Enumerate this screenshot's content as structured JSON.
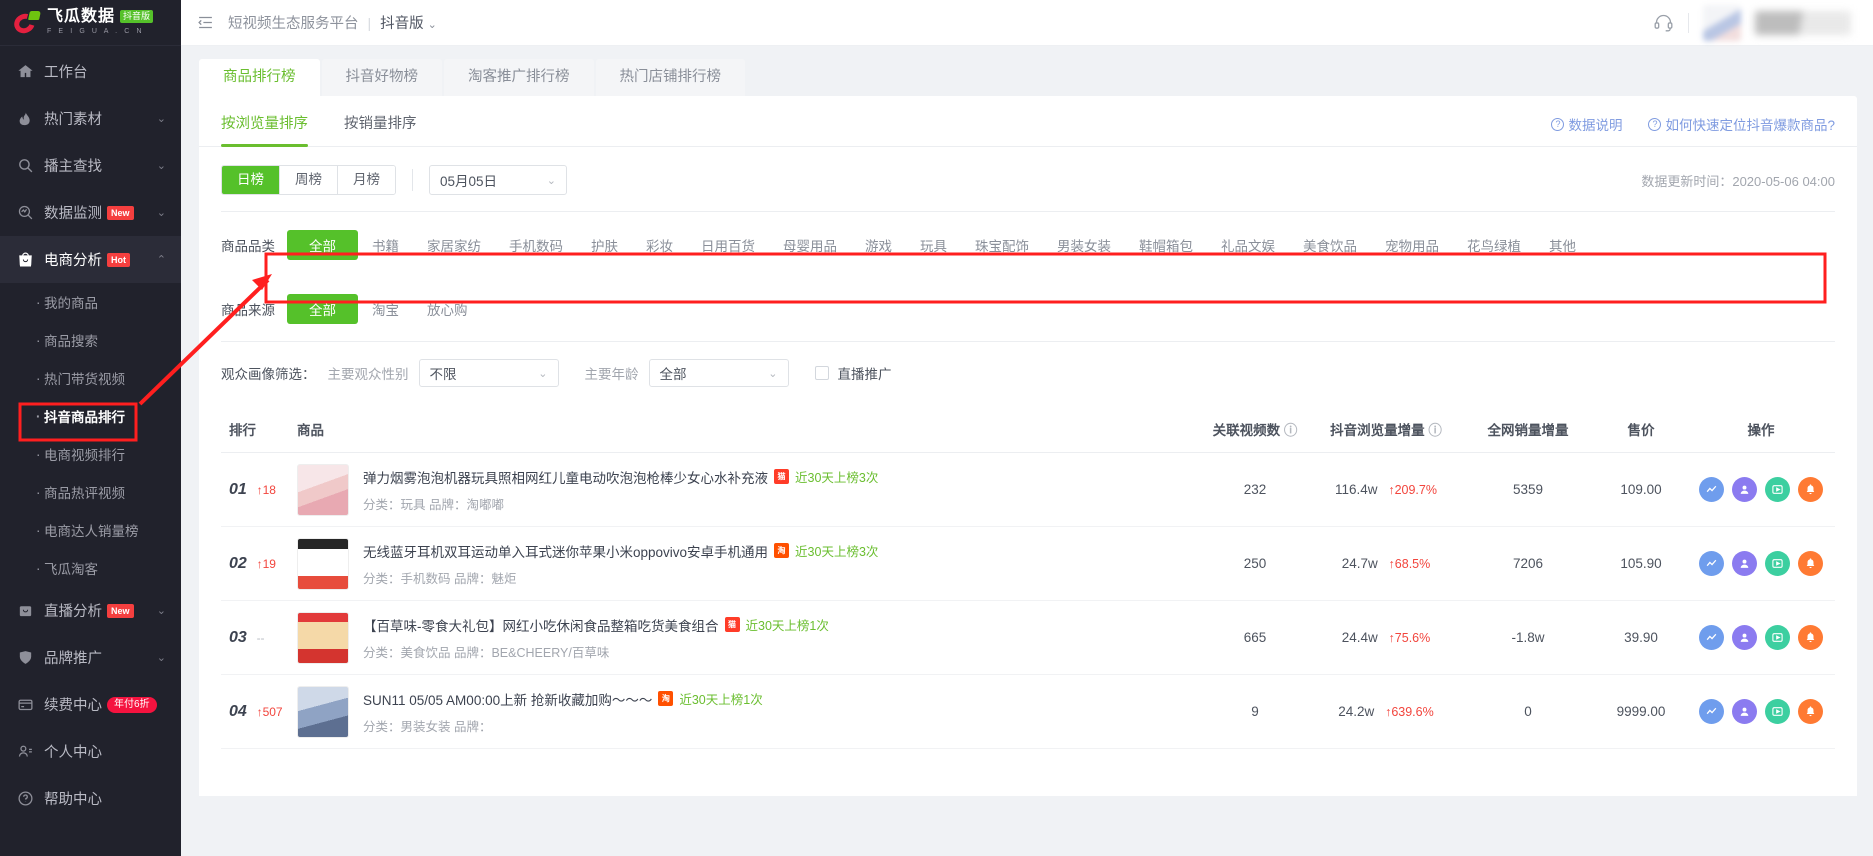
{
  "brand": {
    "name_cn": "飞瓜数据",
    "badge": "抖音版",
    "name_en": "F E I G U A . C N"
  },
  "sidebar": {
    "items": [
      {
        "label": "工作台",
        "icon": "home-icon",
        "tag": "",
        "chevron": false
      },
      {
        "label": "热门素材",
        "icon": "fire-icon",
        "tag": "",
        "chevron": true
      },
      {
        "label": "播主查找",
        "icon": "search-icon",
        "tag": "",
        "chevron": true
      },
      {
        "label": "数据监测",
        "icon": "monitor-icon",
        "tag": "New",
        "chevron": true
      },
      {
        "label": "电商分析",
        "icon": "bag-icon",
        "tag": "Hot",
        "chevron": true,
        "active": true
      }
    ],
    "sub_items": [
      {
        "label": "我的商品"
      },
      {
        "label": "商品搜索"
      },
      {
        "label": "热门带货视频"
      },
      {
        "label": "抖音商品排行",
        "selected": true
      },
      {
        "label": "电商视频排行"
      },
      {
        "label": "商品热评视频"
      },
      {
        "label": "电商达人销量榜"
      },
      {
        "label": "飞瓜淘客"
      }
    ],
    "items_bottom": [
      {
        "label": "直播分析",
        "icon": "live-icon",
        "tag": "New",
        "chevron": true
      },
      {
        "label": "品牌推广",
        "icon": "shield-icon",
        "tag": "",
        "chevron": true
      },
      {
        "label": "续费中心",
        "icon": "card-icon",
        "tag": "年付6折",
        "pill": true,
        "chevron": false
      },
      {
        "label": "个人中心",
        "icon": "user-icon",
        "tag": "",
        "chevron": false
      },
      {
        "label": "帮助中心",
        "icon": "help-icon",
        "tag": "",
        "chevron": false
      }
    ]
  },
  "topbar": {
    "collapse_icon": "collapse-menu-icon",
    "platform_title": "短视频生态服务平台",
    "separator": "|",
    "version": "抖音版",
    "support_icon": "headset-icon"
  },
  "tabs": [
    {
      "label": "商品排行榜",
      "active": true
    },
    {
      "label": "抖音好物榜",
      "active": false
    },
    {
      "label": "淘客推广排行榜",
      "active": false
    },
    {
      "label": "热门店铺排行榜",
      "active": false
    }
  ],
  "subtabs": [
    {
      "label": "按浏览量排序",
      "active": true
    },
    {
      "label": "按销量排序",
      "active": false
    }
  ],
  "help_links": [
    {
      "label": "数据说明"
    },
    {
      "label": "如何快速定位抖音爆款商品?"
    }
  ],
  "period": {
    "options": [
      {
        "label": "日榜",
        "on": true
      },
      {
        "label": "周榜",
        "on": false
      },
      {
        "label": "月榜",
        "on": false
      }
    ],
    "date_value": "05月05日",
    "update_time": "数据更新时间：2020-05-06 04:00"
  },
  "category_filter": {
    "label": "商品品类",
    "options": [
      "全部",
      "书籍",
      "家居家纺",
      "手机数码",
      "护肤",
      "彩妆",
      "日用百货",
      "母婴用品",
      "游戏",
      "玩具",
      "珠宝配饰",
      "男装女装",
      "鞋帽箱包",
      "礼品文娱",
      "美食饮品",
      "宠物用品",
      "花鸟绿植",
      "其他"
    ],
    "selected": "全部"
  },
  "source_filter": {
    "label": "商品来源",
    "options": [
      "全部",
      "淘宝",
      "放心购"
    ],
    "selected": "全部"
  },
  "audience_filter": {
    "label": "观众画像筛选：",
    "gender_label": "主要观众性别",
    "gender_value": "不限",
    "age_label": "主要年龄",
    "age_value": "全部",
    "live_promo_label": "直播推广",
    "live_promo_checked": false
  },
  "table": {
    "headers": [
      {
        "label": "排行",
        "info": false
      },
      {
        "label": "商品",
        "info": false
      },
      {
        "label": "关联视频数",
        "info": true
      },
      {
        "label": "抖音浏览量增量",
        "info": true
      },
      {
        "label": "全网销量增量",
        "info": false
      },
      {
        "label": "售价",
        "info": false
      },
      {
        "label": "操作",
        "info": false
      }
    ],
    "rows": [
      {
        "rank": "01",
        "rank_delta": "↑18",
        "rank_delta_flat": false,
        "title": "弹力烟雾泡泡机器玩具照相网红儿童电动吹泡泡枪棒少女心水补充液",
        "source_badge": "天猫",
        "source_type": "tmall",
        "on_list": "近30天上榜3次",
        "category_line": "分类：玩具 品牌：淘嘟嘟",
        "videos": "232",
        "views": "116.4w",
        "views_delta": "↑209.7%",
        "sales": "5359",
        "price": "109.00"
      },
      {
        "rank": "02",
        "rank_delta": "↑19",
        "rank_delta_flat": false,
        "title": "无线蓝牙耳机双耳运动单入耳式迷你苹果小米oppovivo安卓手机通用",
        "source_badge": "淘",
        "source_type": "taobao",
        "on_list": "近30天上榜3次",
        "category_line": "分类：手机数码 品牌：魅炬",
        "videos": "250",
        "views": "24.7w",
        "views_delta": "↑68.5%",
        "sales": "7206",
        "price": "105.90"
      },
      {
        "rank": "03",
        "rank_delta": "--",
        "rank_delta_flat": true,
        "title": "【百草味-零食大礼包】网红小吃休闲食品整箱吃货美食组合",
        "source_badge": "天猫",
        "source_type": "tmall",
        "on_list": "近30天上榜1次",
        "category_line": "分类：美食饮品 品牌：BE&CHEERY/百草味",
        "videos": "665",
        "views": "24.4w",
        "views_delta": "↑75.6%",
        "sales": "-1.8w",
        "price": "39.90"
      },
      {
        "rank": "04",
        "rank_delta": "↑507",
        "rank_delta_flat": false,
        "title": "SUN11 05/05 AM00:00上新 抢新收藏加购～～～",
        "source_badge": "淘",
        "source_type": "taobao",
        "on_list": "近30天上榜1次",
        "category_line": "分类：男装女装 品牌：",
        "videos": "9",
        "views": "24.2w",
        "views_delta": "↑639.6%",
        "sales": "0",
        "price": "9999.00"
      }
    ],
    "action_buttons": [
      {
        "name": "trend-chart-icon",
        "glyph": "📈"
      },
      {
        "name": "influencer-icon",
        "glyph": "👤"
      },
      {
        "name": "video-play-icon",
        "glyph": "▶"
      },
      {
        "name": "alert-bell-icon",
        "glyph": "🔔"
      }
    ]
  },
  "colors": {
    "accent_green": "#55c12a",
    "link_blue": "#7f9be0",
    "danger_red": "#f2453d",
    "annotation_red": "#ff1f1f",
    "sidebar_bg": "#21222c"
  }
}
